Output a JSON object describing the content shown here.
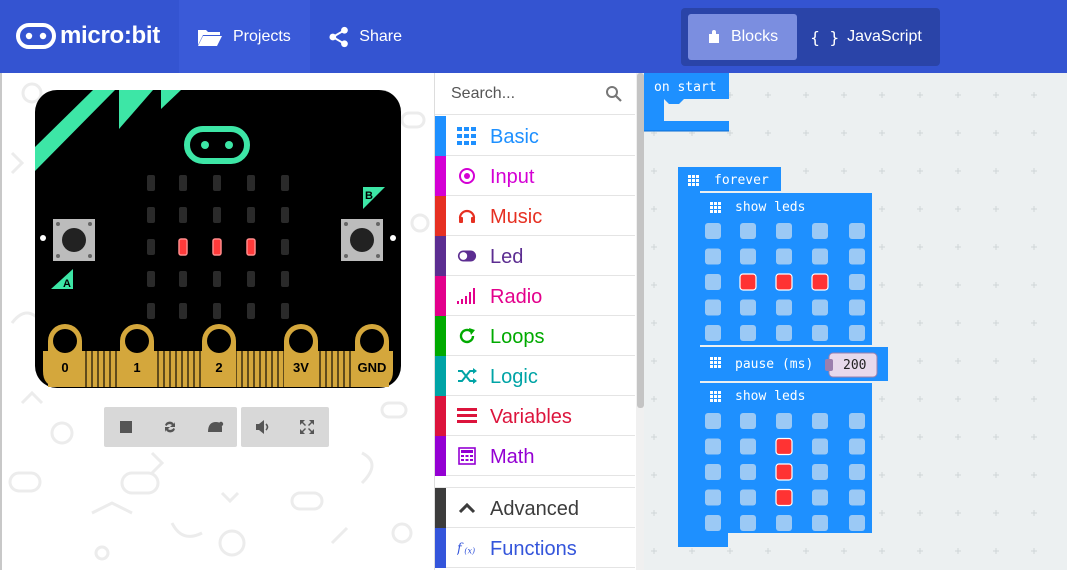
{
  "header": {
    "logo_text": "micro:bit",
    "projects_label": "Projects",
    "share_label": "Share",
    "blocks_label": "Blocks",
    "javascript_label": "JavaScript"
  },
  "simulator": {
    "pins": [
      "0",
      "1",
      "2",
      "3V",
      "GND"
    ],
    "button_a": "A",
    "button_b": "B",
    "leds": [
      [
        0,
        0,
        0,
        0,
        0
      ],
      [
        0,
        0,
        0,
        0,
        0
      ],
      [
        0,
        1,
        1,
        1,
        0
      ],
      [
        0,
        0,
        0,
        0,
        0
      ],
      [
        0,
        0,
        0,
        0,
        0
      ]
    ],
    "controls": [
      "stop-icon",
      "restart-icon",
      "slow-motion-icon",
      "mute-icon",
      "fullscreen-icon"
    ]
  },
  "toolbox": {
    "search_placeholder": "Search...",
    "categories": [
      {
        "label": "Basic",
        "color": "#1E90FF",
        "icon": "grid-icon"
      },
      {
        "label": "Input",
        "color": "#D400D4",
        "icon": "target-icon"
      },
      {
        "label": "Music",
        "color": "#E63022",
        "icon": "headphones-icon"
      },
      {
        "label": "Led",
        "color": "#5C2D91",
        "icon": "toggle-icon"
      },
      {
        "label": "Radio",
        "color": "#E3008C",
        "icon": "signal-icon"
      },
      {
        "label": "Loops",
        "color": "#00AA00",
        "icon": "refresh-icon"
      },
      {
        "label": "Logic",
        "color": "#00A4A6",
        "icon": "shuffle-icon"
      },
      {
        "label": "Variables",
        "color": "#DC143C",
        "icon": "list-icon"
      },
      {
        "label": "Math",
        "color": "#9400D3",
        "icon": "calculator-icon"
      },
      {
        "label": "Advanced",
        "color": "#3C3C3C",
        "icon": "chevron-up-icon"
      },
      {
        "label": "Functions",
        "color": "#3455DB",
        "icon": "function-icon"
      }
    ]
  },
  "workspace": {
    "on_start_label": "on start",
    "forever_label": "forever",
    "show_leds_label": "show leds",
    "pause_label": "pause (ms)",
    "pause_value": "200",
    "show_leds_1": [
      [
        0,
        0,
        0,
        0,
        0
      ],
      [
        0,
        0,
        0,
        0,
        0
      ],
      [
        0,
        1,
        1,
        1,
        0
      ],
      [
        0,
        0,
        0,
        0,
        0
      ],
      [
        0,
        0,
        0,
        0,
        0
      ]
    ],
    "show_leds_2": [
      [
        0,
        0,
        0,
        0,
        0
      ],
      [
        0,
        0,
        1,
        0,
        0
      ],
      [
        0,
        0,
        1,
        0,
        0
      ],
      [
        0,
        0,
        1,
        0,
        0
      ],
      [
        0,
        0,
        0,
        0,
        0
      ]
    ],
    "block_color": "#1E90FF",
    "block_dark": "#0A6DD1",
    "led_off_color": "#9BC9F5",
    "led_on_color": "#FF3333"
  }
}
